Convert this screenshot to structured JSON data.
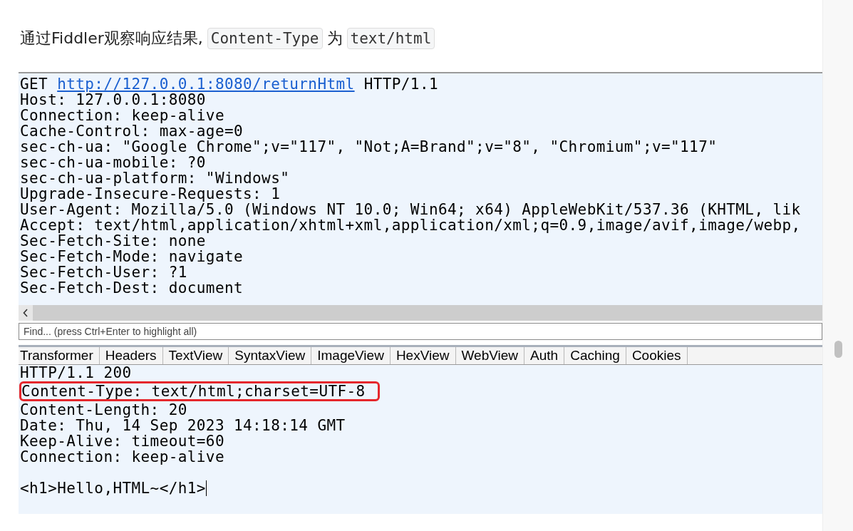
{
  "intro": {
    "parts": [
      {
        "kind": "text",
        "text": "通过Fiddler观察响应结果,"
      },
      {
        "kind": "code",
        "text": "Content-Type"
      },
      {
        "kind": "text",
        "text": "为"
      },
      {
        "kind": "code",
        "text": "text/html"
      }
    ]
  },
  "request": {
    "method": "GET",
    "url": "http://127.0.0.1:8080/returnHtml",
    "protocol": "HTTP/1.1",
    "headers": [
      "Host: 127.0.0.1:8080",
      "Connection: keep-alive",
      "Cache-Control: max-age=0",
      "sec-ch-ua: \"Google Chrome\";v=\"117\", \"Not;A=Brand\";v=\"8\", \"Chromium\";v=\"117\"",
      "sec-ch-ua-mobile: ?0",
      "sec-ch-ua-platform: \"Windows\"",
      "Upgrade-Insecure-Requests: 1",
      "User-Agent: Mozilla/5.0 (Windows NT 10.0; Win64; x64) AppleWebKit/537.36 (KHTML, lik",
      "Accept: text/html,application/xhtml+xml,application/xml;q=0.9,image/avif,image/webp,",
      "Sec-Fetch-Site: none",
      "Sec-Fetch-Mode: navigate",
      "Sec-Fetch-User: ?1",
      "Sec-Fetch-Dest: document"
    ]
  },
  "find": {
    "placeholder": "Find... (press Ctrl+Enter to highlight all)"
  },
  "tabs": [
    "Transformer",
    "Headers",
    "TextView",
    "SyntaxView",
    "ImageView",
    "HexView",
    "WebView",
    "Auth",
    "Caching",
    "Cookies"
  ],
  "response": {
    "lines": [
      {
        "text": "HTTP/1.1 200",
        "highlighted": false
      },
      {
        "text": "Content-Type: text/html;charset=UTF-8",
        "highlighted": true
      },
      {
        "text": "Content-Length: 20",
        "highlighted": false
      },
      {
        "text": "Date: Thu, 14 Sep 2023 14:18:14 GMT",
        "highlighted": false
      },
      {
        "text": "Keep-Alive: timeout=60",
        "highlighted": false
      },
      {
        "text": "Connection: keep-alive",
        "highlighted": false
      }
    ],
    "body": "<h1>Hello,HTML~</h1>"
  }
}
